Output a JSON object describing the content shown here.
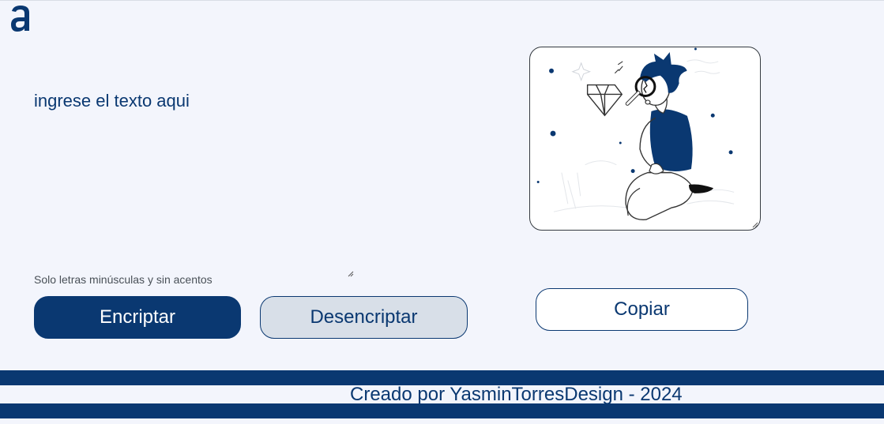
{
  "input": {
    "placeholder": "ingrese el texto aqui",
    "hint": "Solo letras minúsculas y sin acentos"
  },
  "buttons": {
    "encrypt": "Encriptar",
    "decrypt": "Desencriptar",
    "copy": "Copiar"
  },
  "footer": {
    "credit": "Creado por YasminTorresDesign - 2024"
  },
  "colors": {
    "primary": "#0a3871",
    "background": "#f3f5fc",
    "secondary_button": "#d8dfe8"
  },
  "icons": {
    "logo": "alura-logo-icon",
    "illustration": "person-with-magnifying-glass-and-diamond"
  }
}
